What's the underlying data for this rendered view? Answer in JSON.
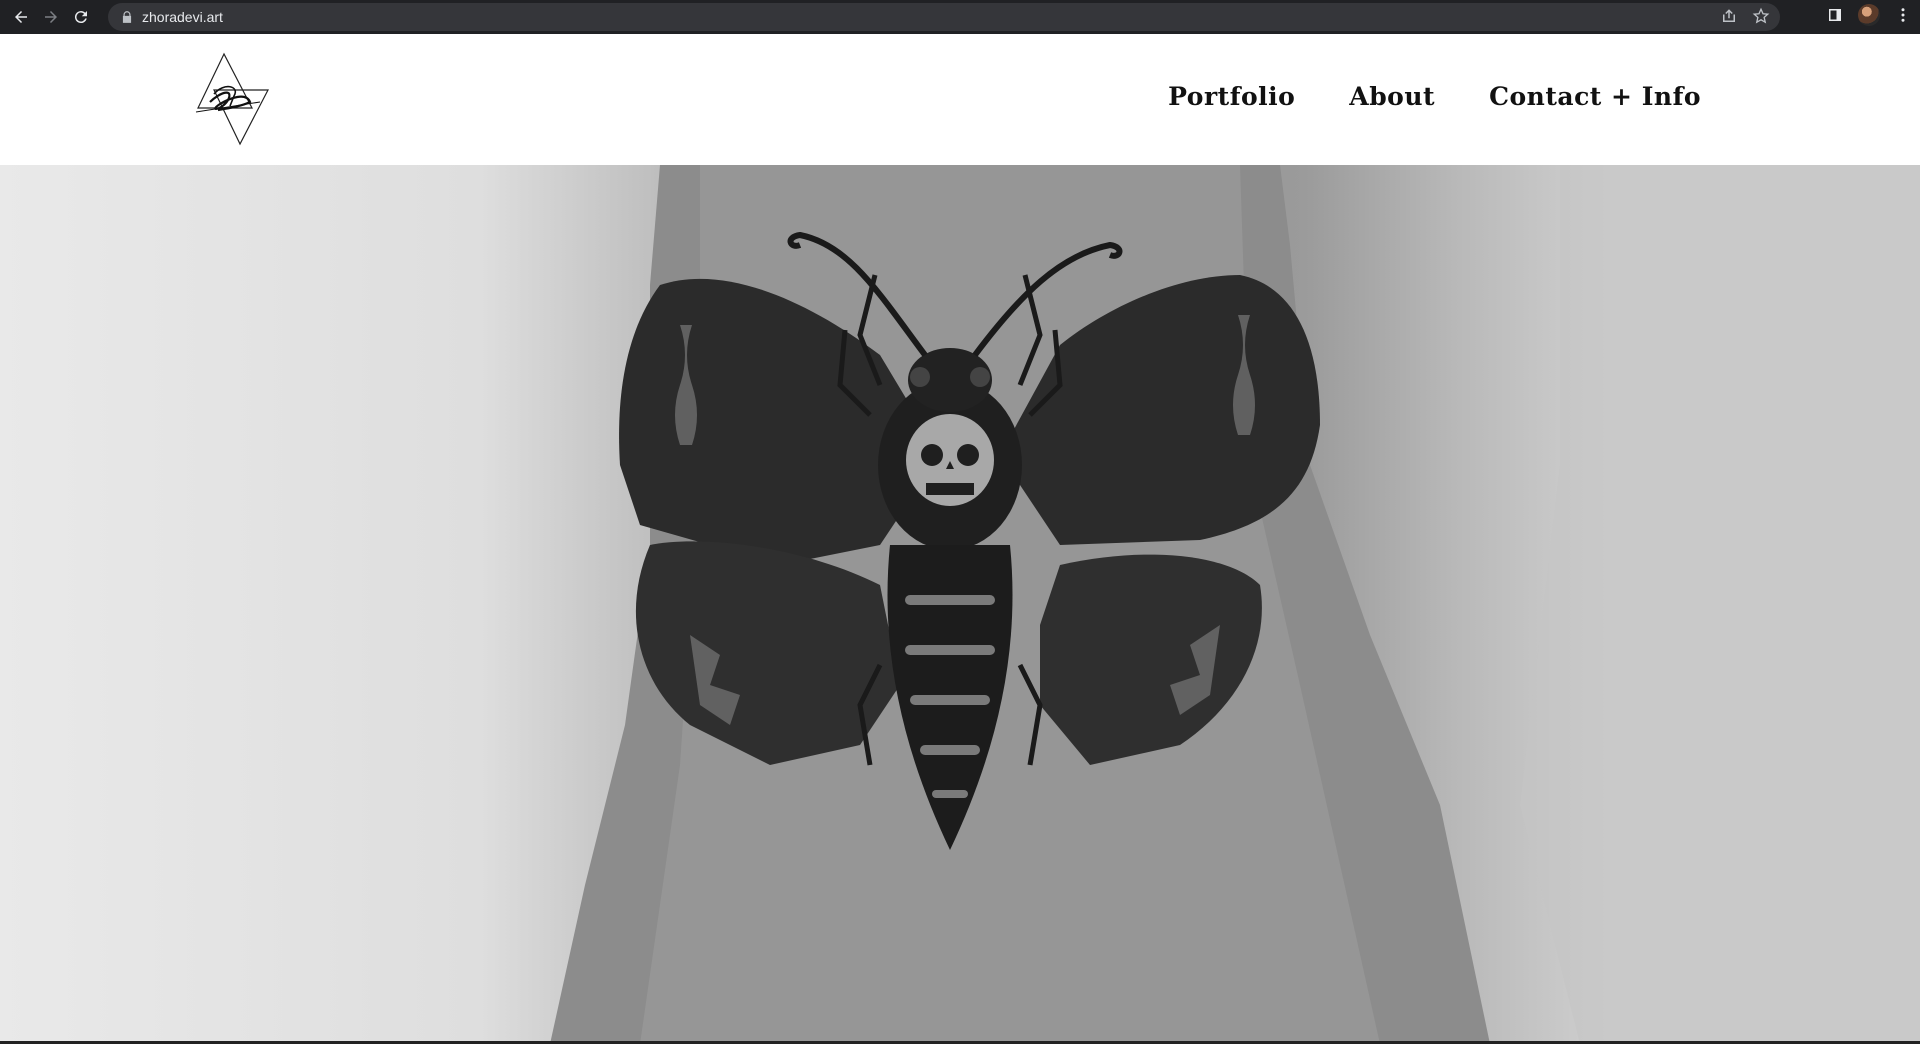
{
  "browser": {
    "url": "zhoradevi.art",
    "icons": [
      "back-icon",
      "forward-icon",
      "reload-icon",
      "lock-icon",
      "share-icon",
      "star-icon",
      "side-panel-icon",
      "profile-avatar",
      "menu-icon"
    ]
  },
  "site": {
    "logo_icon": "signature-triangle-logo",
    "nav": [
      "Portfolio",
      "About",
      "Contact + Info"
    ]
  },
  "hero": {
    "image": "black-and-white photo of a death's-head moth tattoo on the back of a hand"
  },
  "colors": {
    "chrome_bg": "#202124",
    "omnibox_bg": "#35363a",
    "nav_text": "#111111",
    "page_bg": "#ffffff"
  }
}
